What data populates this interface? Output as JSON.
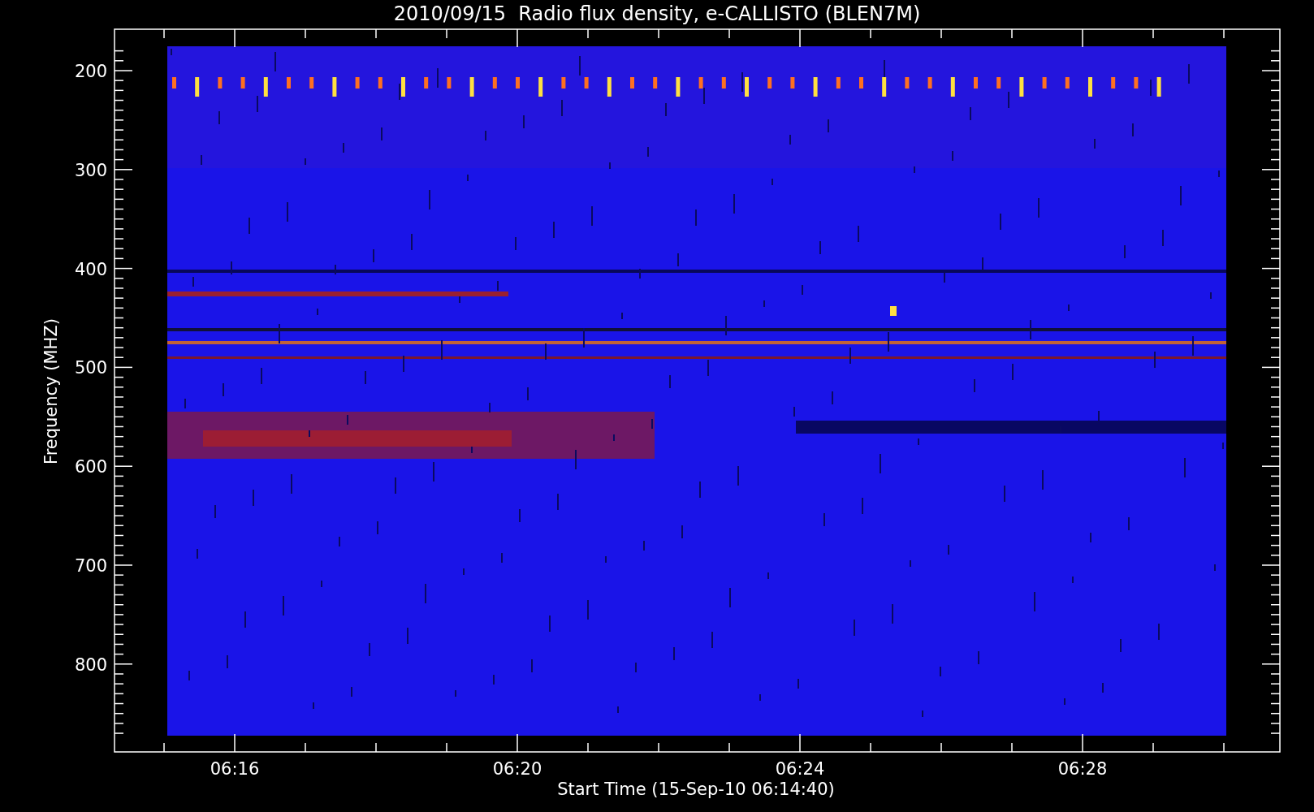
{
  "title": "2010/09/15  Radio flux density, e-CALLISTO (BLEN7M)",
  "y_axis": {
    "label": "Frequency (MHZ)",
    "ticks": [
      "200",
      "300",
      "400",
      "500",
      "600",
      "700",
      "800"
    ]
  },
  "x_axis": {
    "label": "Start Time (15-Sep-10 06:14:40)",
    "ticks": [
      "06:16",
      "06:20",
      "06:24",
      "06:28"
    ]
  }
}
